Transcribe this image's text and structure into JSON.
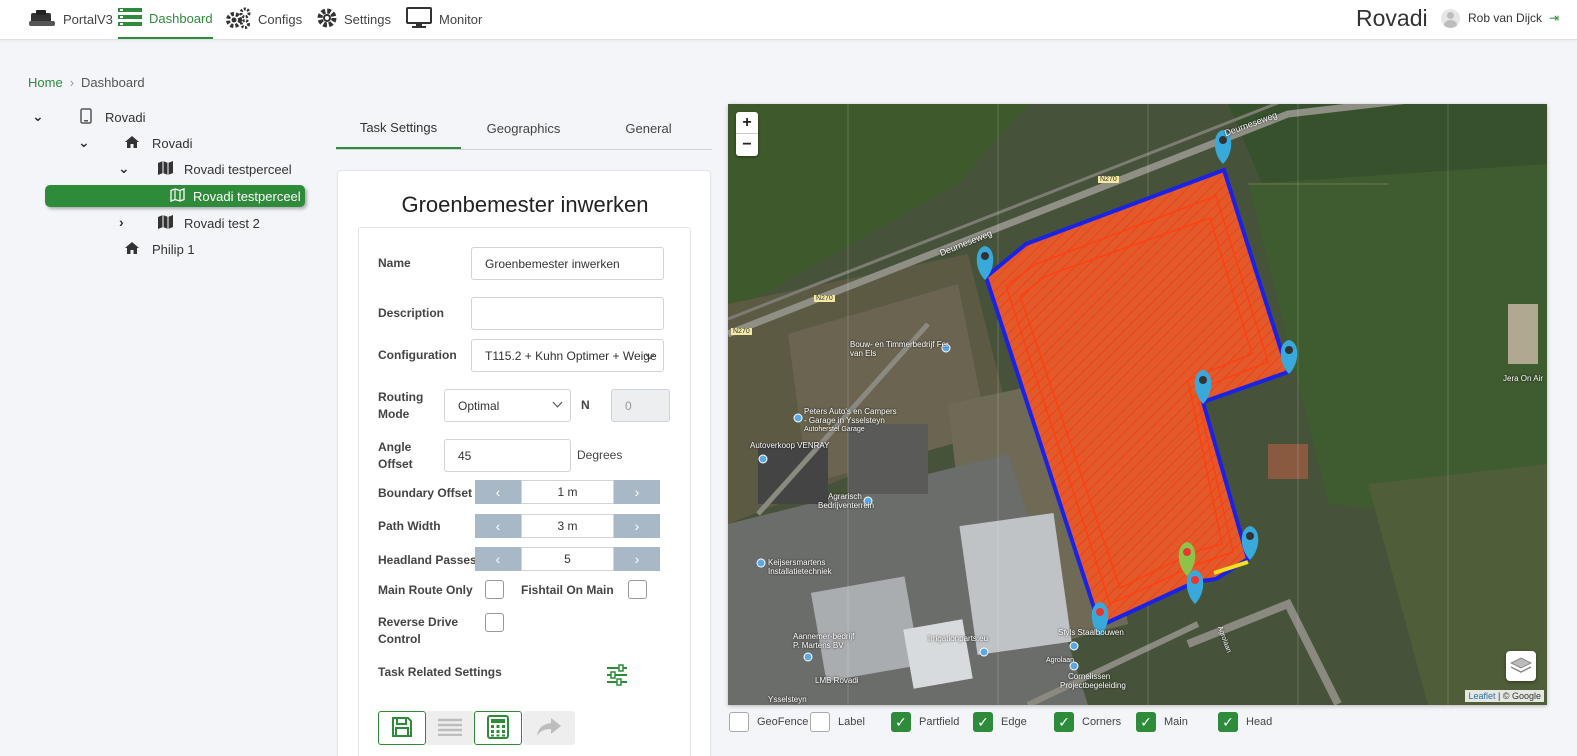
{
  "nav": {
    "items": [
      {
        "label": "PortalV3",
        "icon": "robot-logo-icon",
        "active": false
      },
      {
        "label": "Dashboard",
        "icon": "dashboard-icon",
        "active": true
      },
      {
        "label": "Configs",
        "icon": "gears-icon",
        "active": false
      },
      {
        "label": "Settings",
        "icon": "gear-icon",
        "active": false
      },
      {
        "label": "Monitor",
        "icon": "monitor-icon",
        "active": false
      }
    ],
    "brand": "Rovadi",
    "user": "Rob van Dijck"
  },
  "breadcrumb": {
    "home": "Home",
    "current": "Dashboard"
  },
  "tree": [
    {
      "label": "Rovadi",
      "icon": "device-icon",
      "expanded": true
    },
    {
      "label": "Rovadi",
      "icon": "home-icon",
      "expanded": true
    },
    {
      "label": "Rovadi testperceel",
      "icon": "map-icon",
      "expanded": true
    },
    {
      "label": "Rovadi testperceel",
      "icon": "map-outline-icon",
      "selected": true
    },
    {
      "label": "Rovadi test 2",
      "icon": "map-icon",
      "expanded": false
    },
    {
      "label": "Philip 1",
      "icon": "home-icon"
    }
  ],
  "tabs": [
    {
      "label": "Task Settings",
      "active": true
    },
    {
      "label": "Geographics",
      "active": false
    },
    {
      "label": "General",
      "active": false
    }
  ],
  "form": {
    "title": "Groenbemester inwerken",
    "name_label": "Name",
    "name_value": "Groenbemester inwerken",
    "description_label": "Description",
    "description_value": "",
    "configuration_label": "Configuration",
    "configuration_value": "T115.2 + Kuhn Optimer + Weige",
    "routing_label_1": "Routing",
    "routing_label_2": "Mode",
    "routing_value": "Optimal",
    "n_label": "N",
    "n_value": "0",
    "angle_label_1": "Angle",
    "angle_label_2": "Offset",
    "angle_value": "45",
    "angle_unit": "Degrees",
    "boundary_label": "Boundary Offset",
    "boundary_value": "1 m",
    "path_label": "Path Width",
    "path_value": "3 m",
    "headland_label": "Headland Passes",
    "headland_value": "5",
    "main_route_label": "Main Route Only",
    "fishtail_label": "Fishtail On Main",
    "reverse_label_1": "Reverse Drive",
    "reverse_label_2": "Control",
    "task_related_label": "Task Related Settings"
  },
  "map": {
    "labels": {
      "road1": "Deurneseweg",
      "road2": "Deurneseweg",
      "n270a": "N270",
      "n270b": "N270",
      "n270c": "N270",
      "poi1": "Bouw- en Timmerbedrijf Fer van Els",
      "poi2a": "Peters Auto's en Campers",
      "poi2b": "- Garage in Ysselsteyn",
      "poi2c": "Autoherstel Garage",
      "poi3": "Autoverkoop VENRAY",
      "poi4a": "Agrarisch",
      "poi4b": "Bedrijventerrein",
      "poi5a": "Keijsersmartens",
      "poi5b": "Installatietechniek",
      "poi6a": "Aannemer-bedrijf",
      "poi6b": "P. Martens BV",
      "poi7": "LMB Rovadi",
      "poi8": "Styls Staalbouwen",
      "poi9": "Irrigationparts.eu",
      "poi10": "Agrolaan",
      "poi11a": "Cornelissen",
      "poi11b": "Projectbegeleiding",
      "poi12": "Jera On Air",
      "poi13": "Ysselsteyn",
      "poi14": "Agrolaan"
    },
    "attribution_leaflet": "Leaflet",
    "attribution_rest": "| © Google",
    "zoom_in": "+",
    "zoom_out": "−"
  },
  "legend": [
    {
      "label": "GeoFence",
      "checked": false
    },
    {
      "label": "Label",
      "checked": false
    },
    {
      "label": "Partfield",
      "checked": true
    },
    {
      "label": "Edge",
      "checked": true
    },
    {
      "label": "Corners",
      "checked": true
    },
    {
      "label": "Main",
      "checked": true
    },
    {
      "label": "Head",
      "checked": true
    }
  ],
  "colors": {
    "accent": "#2e8b3a",
    "field_fill": "#e2562a",
    "boundary": "#1a22e8",
    "marker": "#39a9dc"
  }
}
